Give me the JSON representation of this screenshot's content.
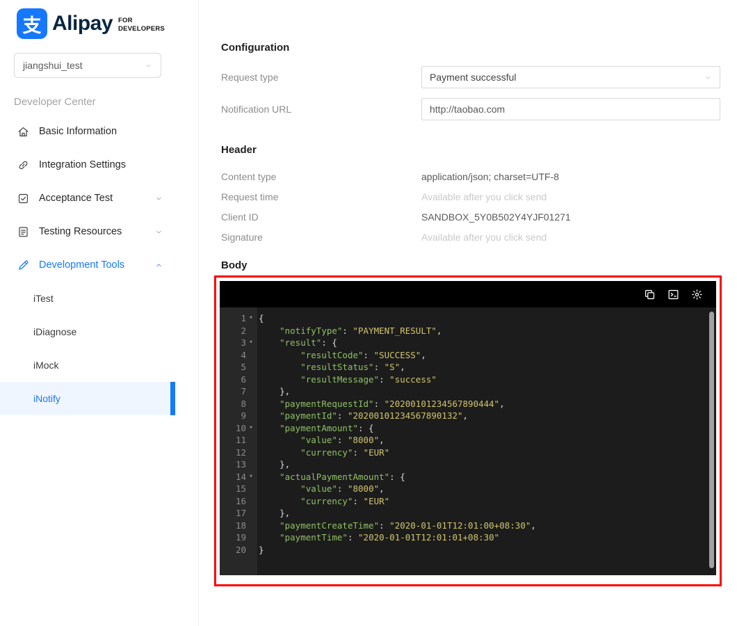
{
  "accent_color": "#1677ff",
  "brand": {
    "logo_glyph": "支",
    "name": "Alipay",
    "tagline_line1": "FOR",
    "tagline_line2": "DEVELOPERS"
  },
  "sidebar": {
    "account_select": {
      "value": "jiangshui_test"
    },
    "section_title": "Developer Center",
    "items": [
      {
        "label": "Basic Information",
        "icon": "home-icon",
        "active": false
      },
      {
        "label": "Integration Settings",
        "icon": "integration-icon",
        "active": false
      },
      {
        "label": "Acceptance Test",
        "icon": "acceptance-test-icon",
        "chevron": "down",
        "active": false
      },
      {
        "label": "Testing Resources",
        "icon": "testing-resources-icon",
        "chevron": "down",
        "active": false
      },
      {
        "label": "Development Tools",
        "icon": "development-tools-icon",
        "chevron": "up",
        "active": true
      }
    ],
    "sub_items": [
      {
        "label": "iTest",
        "selected": false
      },
      {
        "label": "iDiagnose",
        "selected": false
      },
      {
        "label": "iMock",
        "selected": false
      },
      {
        "label": "iNotify",
        "selected": true
      }
    ]
  },
  "main": {
    "configuration": {
      "title": "Configuration",
      "fields": [
        {
          "label": "Request type",
          "type": "select",
          "value": "Payment successful"
        },
        {
          "label": "Notification URL",
          "type": "input",
          "value": "http://taobao.com"
        }
      ]
    },
    "header_section": {
      "title": "Header",
      "rows": [
        {
          "label": "Content type",
          "value": "application/json; charset=UTF-8",
          "muted": false
        },
        {
          "label": "Request time",
          "value": "Available after you click send",
          "muted": true
        },
        {
          "label": "Client ID",
          "value": "SANDBOX_5Y0B502Y4YJF01271",
          "muted": false
        },
        {
          "label": "Signature",
          "value": "Available after you click send",
          "muted": true
        }
      ]
    },
    "body_section": {
      "title": "Body",
      "annotation_color": "#ff0000",
      "editor": {
        "toolbar_icons": [
          "copy-icon",
          "console-icon",
          "settings-icon"
        ],
        "colors": {
          "background": "#1c1c1c",
          "gutter": "#282828",
          "toolbar": "#000000",
          "key": "#8fc164",
          "string": "#d2c56a",
          "punct": "#dcdcdc"
        },
        "lines": [
          {
            "n": 1,
            "fold": true,
            "tokens": [
              {
                "c": "p",
                "t": "{"
              }
            ]
          },
          {
            "n": 2,
            "fold": false,
            "tokens": [
              {
                "c": "p",
                "t": "    "
              },
              {
                "c": "k",
                "t": "\"notifyType\""
              },
              {
                "c": "p",
                "t": ": "
              },
              {
                "c": "v",
                "t": "\"PAYMENT_RESULT\""
              },
              {
                "c": "p",
                "t": ","
              }
            ]
          },
          {
            "n": 3,
            "fold": true,
            "tokens": [
              {
                "c": "p",
                "t": "    "
              },
              {
                "c": "k",
                "t": "\"result\""
              },
              {
                "c": "p",
                "t": ": {"
              }
            ]
          },
          {
            "n": 4,
            "fold": false,
            "tokens": [
              {
                "c": "p",
                "t": "        "
              },
              {
                "c": "k",
                "t": "\"resultCode\""
              },
              {
                "c": "p",
                "t": ": "
              },
              {
                "c": "v",
                "t": "\"SUCCESS\""
              },
              {
                "c": "p",
                "t": ","
              }
            ]
          },
          {
            "n": 5,
            "fold": false,
            "tokens": [
              {
                "c": "p",
                "t": "        "
              },
              {
                "c": "k",
                "t": "\"resultStatus\""
              },
              {
                "c": "p",
                "t": ": "
              },
              {
                "c": "v",
                "t": "\"S\""
              },
              {
                "c": "p",
                "t": ","
              }
            ]
          },
          {
            "n": 6,
            "fold": false,
            "tokens": [
              {
                "c": "p",
                "t": "        "
              },
              {
                "c": "k",
                "t": "\"resultMessage\""
              },
              {
                "c": "p",
                "t": ": "
              },
              {
                "c": "v",
                "t": "\"success\""
              }
            ]
          },
          {
            "n": 7,
            "fold": false,
            "tokens": [
              {
                "c": "p",
                "t": "    },"
              }
            ]
          },
          {
            "n": 8,
            "fold": false,
            "tokens": [
              {
                "c": "p",
                "t": "    "
              },
              {
                "c": "k",
                "t": "\"paymentRequestId\""
              },
              {
                "c": "p",
                "t": ": "
              },
              {
                "c": "v",
                "t": "\"20200101234567890444\""
              },
              {
                "c": "p",
                "t": ","
              }
            ]
          },
          {
            "n": 9,
            "fold": false,
            "tokens": [
              {
                "c": "p",
                "t": "    "
              },
              {
                "c": "k",
                "t": "\"paymentId\""
              },
              {
                "c": "p",
                "t": ": "
              },
              {
                "c": "v",
                "t": "\"20200101234567890132\""
              },
              {
                "c": "p",
                "t": ","
              }
            ]
          },
          {
            "n": 10,
            "fold": true,
            "tokens": [
              {
                "c": "p",
                "t": "    "
              },
              {
                "c": "k",
                "t": "\"paymentAmount\""
              },
              {
                "c": "p",
                "t": ": {"
              }
            ]
          },
          {
            "n": 11,
            "fold": false,
            "tokens": [
              {
                "c": "p",
                "t": "        "
              },
              {
                "c": "k",
                "t": "\"value\""
              },
              {
                "c": "p",
                "t": ": "
              },
              {
                "c": "v",
                "t": "\"8000\""
              },
              {
                "c": "p",
                "t": ","
              }
            ]
          },
          {
            "n": 12,
            "fold": false,
            "tokens": [
              {
                "c": "p",
                "t": "        "
              },
              {
                "c": "k",
                "t": "\"currency\""
              },
              {
                "c": "p",
                "t": ": "
              },
              {
                "c": "v",
                "t": "\"EUR\""
              }
            ]
          },
          {
            "n": 13,
            "fold": false,
            "tokens": [
              {
                "c": "p",
                "t": "    },"
              }
            ]
          },
          {
            "n": 14,
            "fold": true,
            "tokens": [
              {
                "c": "p",
                "t": "    "
              },
              {
                "c": "k",
                "t": "\"actualPaymentAmount\""
              },
              {
                "c": "p",
                "t": ": {"
              }
            ]
          },
          {
            "n": 15,
            "fold": false,
            "tokens": [
              {
                "c": "p",
                "t": "        "
              },
              {
                "c": "k",
                "t": "\"value\""
              },
              {
                "c": "p",
                "t": ": "
              },
              {
                "c": "v",
                "t": "\"8000\""
              },
              {
                "c": "p",
                "t": ","
              }
            ]
          },
          {
            "n": 16,
            "fold": false,
            "tokens": [
              {
                "c": "p",
                "t": "        "
              },
              {
                "c": "k",
                "t": "\"currency\""
              },
              {
                "c": "p",
                "t": ": "
              },
              {
                "c": "v",
                "t": "\"EUR\""
              }
            ]
          },
          {
            "n": 17,
            "fold": false,
            "tokens": [
              {
                "c": "p",
                "t": "    },"
              }
            ]
          },
          {
            "n": 18,
            "fold": false,
            "tokens": [
              {
                "c": "p",
                "t": "    "
              },
              {
                "c": "k",
                "t": "\"paymentCreateTime\""
              },
              {
                "c": "p",
                "t": ": "
              },
              {
                "c": "v",
                "t": "\"2020-01-01T12:01:00+08:30\""
              },
              {
                "c": "p",
                "t": ","
              }
            ]
          },
          {
            "n": 19,
            "fold": false,
            "tokens": [
              {
                "c": "p",
                "t": "    "
              },
              {
                "c": "k",
                "t": "\"paymentTime\""
              },
              {
                "c": "p",
                "t": ": "
              },
              {
                "c": "v",
                "t": "\"2020-01-01T12:01:01+08:30\""
              }
            ]
          },
          {
            "n": 20,
            "fold": false,
            "tokens": [
              {
                "c": "p",
                "t": "}"
              }
            ]
          }
        ]
      }
    }
  }
}
